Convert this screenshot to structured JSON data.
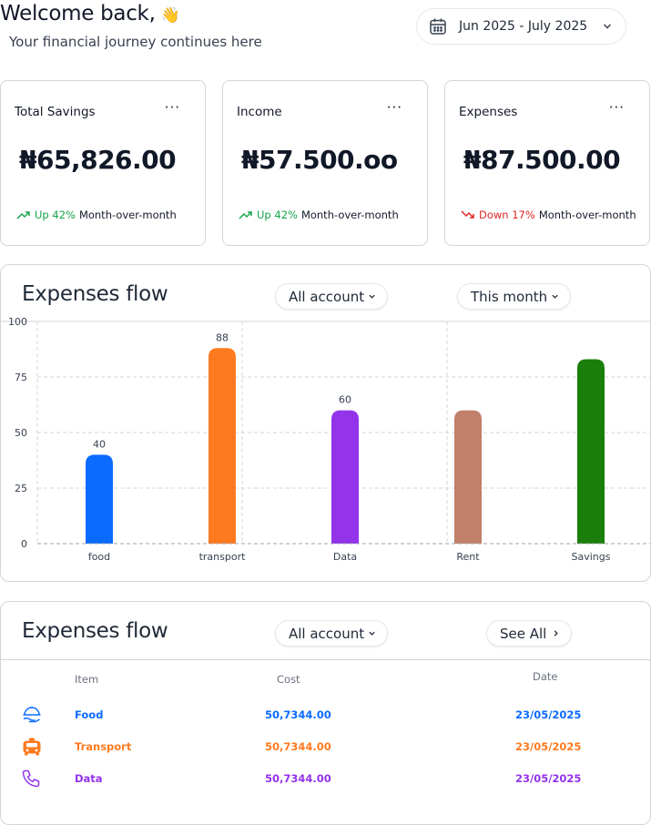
{
  "header": {
    "welcome": "Welcome back,",
    "wave": "👋",
    "subtitle": "Your financial journey continues here",
    "date_range": "Jun 2025 - July 2025",
    "date_icon": "calendar-icon"
  },
  "cards": [
    {
      "title": "Total Savings",
      "menu": "···",
      "amount": "₦65,826.00",
      "trend_dir": "up",
      "trend_text": "Up 42%",
      "trend_suffix": "Month-over-month"
    },
    {
      "title": "Income",
      "menu": "···",
      "amount": "₦57.500.oo",
      "trend_dir": "up",
      "trend_text": "Up 42%",
      "trend_suffix": "Month-over-month"
    },
    {
      "title": "Expenses",
      "menu": "···",
      "amount": "₦87.500.00",
      "trend_dir": "down",
      "trend_text": "Down 17%",
      "trend_suffix": "Month-over-month"
    }
  ],
  "colors": {
    "up": "#16a34a",
    "down": "#dc2626",
    "food": "#0b6bff",
    "transport": "#ff7a1f",
    "data": "#9333ea",
    "rent": "#c0806a",
    "savings": "#1a7f0a"
  },
  "chart_panel": {
    "title": "Expenses flow",
    "filter_account": "All account",
    "filter_period": "This month"
  },
  "chart_data": {
    "type": "bar",
    "categories": [
      "food",
      "transport",
      "Data",
      "Rent",
      "Savings"
    ],
    "values": [
      40,
      88,
      60,
      60,
      83
    ],
    "data_labels": [
      "40",
      "88",
      "60",
      "",
      ""
    ],
    "colors": [
      "#0b6bff",
      "#ff7a1f",
      "#9333ea",
      "#c0806a",
      "#1a7f0a"
    ],
    "ylim": [
      0,
      100
    ],
    "yticks": [
      0,
      25,
      50,
      75,
      100
    ],
    "grid": true,
    "title": "",
    "xlabel": "",
    "ylabel": ""
  },
  "table_panel": {
    "title": "Expenses flow",
    "filter_account": "All account",
    "see_all": "See All",
    "columns": {
      "item": "Item",
      "cost": "Cost",
      "date": "Date"
    },
    "rows": [
      {
        "icon": "food-delivery-icon",
        "item": "Food",
        "cost": "50,7344.00",
        "date": "23/05/2025",
        "color": "#0b6bff"
      },
      {
        "icon": "taxi-icon",
        "item": "Transport",
        "cost": "50,7344.00",
        "date": "23/05/2025",
        "color": "#ff7a1f"
      },
      {
        "icon": "phone-icon",
        "item": "Data",
        "cost": "50,7344.00",
        "date": "23/05/2025",
        "color": "#9333ea"
      }
    ]
  }
}
